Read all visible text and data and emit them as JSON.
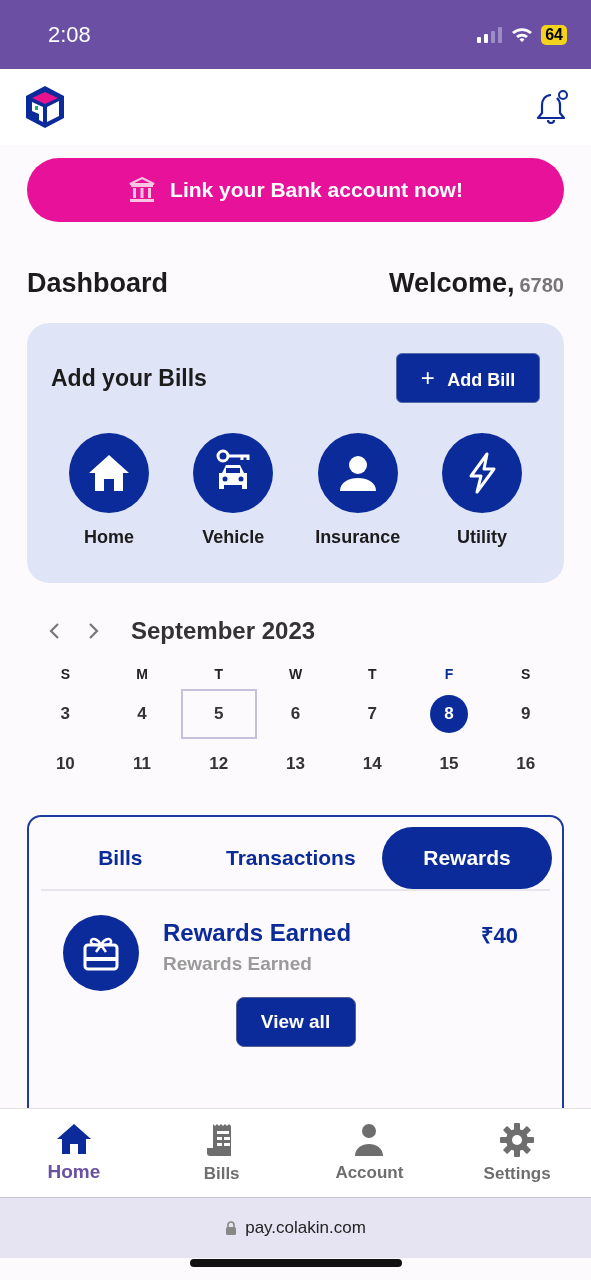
{
  "status_bar": {
    "time": "2:08",
    "battery": "64"
  },
  "banner": {
    "label": "Link your Bank account now!"
  },
  "dashboard": {
    "title": "Dashboard",
    "welcome": "Welcome,",
    "user": "6780"
  },
  "bills_card": {
    "title": "Add your Bills",
    "add_button": "Add Bill",
    "plus": "+",
    "categories": [
      {
        "label": "Home"
      },
      {
        "label": "Vehicle"
      },
      {
        "label": "Insurance"
      },
      {
        "label": "Utility"
      }
    ]
  },
  "calendar": {
    "month": "September 2023",
    "weekdays": [
      {
        "label": "S",
        "selected": false
      },
      {
        "label": "M",
        "selected": false
      },
      {
        "label": "T",
        "selected": false
      },
      {
        "label": "W",
        "selected": false
      },
      {
        "label": "T",
        "selected": false
      },
      {
        "label": "F",
        "selected": true
      },
      {
        "label": "S",
        "selected": false
      }
    ],
    "days": [
      {
        "label": "3",
        "selected": false,
        "today": false
      },
      {
        "label": "4",
        "selected": false,
        "today": false
      },
      {
        "label": "5",
        "selected": false,
        "today": true
      },
      {
        "label": "6",
        "selected": false,
        "today": false
      },
      {
        "label": "7",
        "selected": false,
        "today": false
      },
      {
        "label": "8",
        "selected": true,
        "today": false
      },
      {
        "label": "9",
        "selected": false,
        "today": false
      },
      {
        "label": "10",
        "selected": false,
        "today": false
      },
      {
        "label": "11",
        "selected": false,
        "today": false
      },
      {
        "label": "12",
        "selected": false,
        "today": false
      },
      {
        "label": "13",
        "selected": false,
        "today": false
      },
      {
        "label": "14",
        "selected": false,
        "today": false
      },
      {
        "label": "15",
        "selected": false,
        "today": false
      },
      {
        "label": "16",
        "selected": false,
        "today": false
      }
    ]
  },
  "activity": {
    "tabs": [
      {
        "label": "Bills",
        "selected": false
      },
      {
        "label": "Transactions",
        "selected": false
      },
      {
        "label": "Rewards",
        "selected": true
      }
    ],
    "reward": {
      "title": "Rewards Earned",
      "subtitle": "Rewards Earned",
      "amount": "₹40"
    },
    "view_all": "View all"
  },
  "bottom_nav": [
    {
      "label": "Home",
      "selected": true
    },
    {
      "label": "Bills",
      "selected": false
    },
    {
      "label": "Account",
      "selected": false
    },
    {
      "label": "Settings",
      "selected": false
    }
  ],
  "url_bar": {
    "url": "pay.colakin.com"
  }
}
